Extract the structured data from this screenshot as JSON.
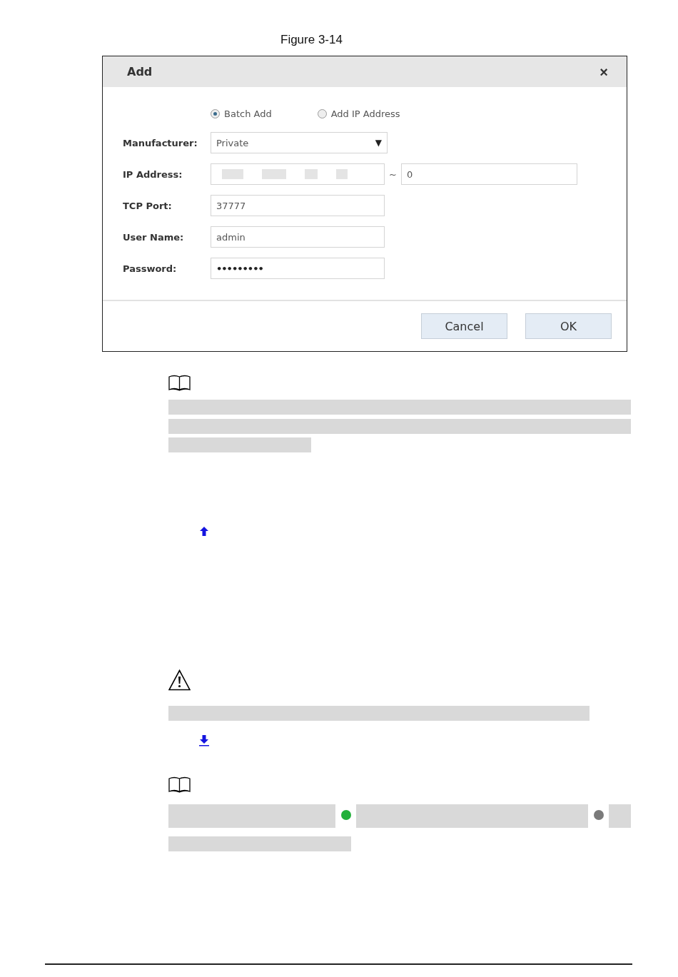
{
  "figure_caption": "Figure 3-14",
  "dialog": {
    "title": "Add",
    "close": "×",
    "modes": [
      {
        "label": "Batch Add",
        "selected": true
      },
      {
        "label": "Add IP Address",
        "selected": false
      }
    ],
    "fields": [
      {
        "kind": "select",
        "label": "Manufacturer:",
        "value": "Private",
        "caret": "▼"
      },
      {
        "kind": "range",
        "label": "IP Address:",
        "separator": "~",
        "end_value": "0"
      },
      {
        "kind": "text",
        "label": "TCP Port:",
        "value": "37777"
      },
      {
        "kind": "text",
        "label": "User Name:",
        "value": "admin"
      },
      {
        "kind": "password",
        "label": "Password:",
        "value": "•••••••••"
      }
    ],
    "buttons": [
      "Cancel",
      "OK"
    ]
  }
}
